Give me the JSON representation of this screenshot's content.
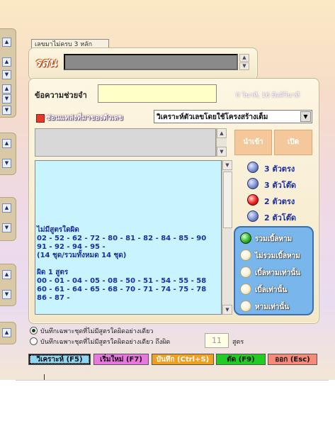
{
  "top_tab": {
    "label": "เลขมาไม่ครบ 3 หลัก"
  },
  "result": {
    "label": "รสน",
    "value": ""
  },
  "help": {
    "label": "ข้อความช่วยจำ",
    "value": "",
    "timer": "0 วินาที, 16 มิลลิวินาที"
  },
  "source": {
    "label": "ซ่อนแหล่งที่มาของตัวเลข",
    "checked": false
  },
  "mode": {
    "selected": "วิเคราะห์ตัวเลขโดยใช้โครงสร้างเต็ม"
  },
  "import_button": "นำเข้า",
  "open_button": "เปิด",
  "output_lines": [
    "ไม่มีสูตรใดผิด",
    "02 - 52 - 62 - 72 - 80 - 81 - 82 - 84 - 85 - 90",
    "91 - 92 - 94 - 95 -",
    "(14 ชุด/รวมทั้งหมด 14 ชุด)",
    "",
    "ผิด 1 สูตร",
    "00 - 01 - 04 - 05 - 08 - 50 - 51 - 54 - 55 - 58",
    "60 - 61 - 64 - 65 - 68 - 70 - 71 - 74 - 75 - 78",
    "86 - 87 -"
  ],
  "match_modes": [
    {
      "label": "3 ตัวตรง",
      "color": "blue"
    },
    {
      "label": "3 ตัวโต๊ด",
      "color": "blue"
    },
    {
      "label": "2 ตัวตรง",
      "color": "red"
    },
    {
      "label": "2 ตัวโต๊ด",
      "color": "blue"
    }
  ],
  "dup_modes": [
    {
      "label": "รวมเบิ้ลหาม",
      "color": "green"
    },
    {
      "label": "ไม่รวมเบิ้ลหาม",
      "color": "cream"
    },
    {
      "label": "เบิ้ลหามเท่านั้น",
      "color": "cream"
    },
    {
      "label": "เบิ้ลเท่านั้น",
      "color": "cream"
    },
    {
      "label": "หามเท่านั้น",
      "color": "cream"
    }
  ],
  "save_options": {
    "opt1": "บันทึกเฉพาะชุดที่ไม่มีสูตรใดผิดอย่างเดียว",
    "opt2": "บันทึกเฉพาะชุดที่ไม่มีสูตรใดผิดอย่างเดียว ถึงผิด",
    "count": "11",
    "unit": "สูตร"
  },
  "footer_buttons": {
    "analyze": "วิเคราะห์ (F5)",
    "new": "เริ่มใหม่ (F7)",
    "save": "บันทึก (Ctrl+S)",
    "cut": "ตัด (F9)",
    "exit": "ออก (Esc)"
  },
  "colors": {
    "accent_blue": "#1b2fa0",
    "analyze_bg": "#8dd7f2",
    "new_bg": "#e878e0",
    "save_bg": "#f0a020",
    "cut_bg": "#22cc22",
    "exit_bg": "#f58a78"
  }
}
